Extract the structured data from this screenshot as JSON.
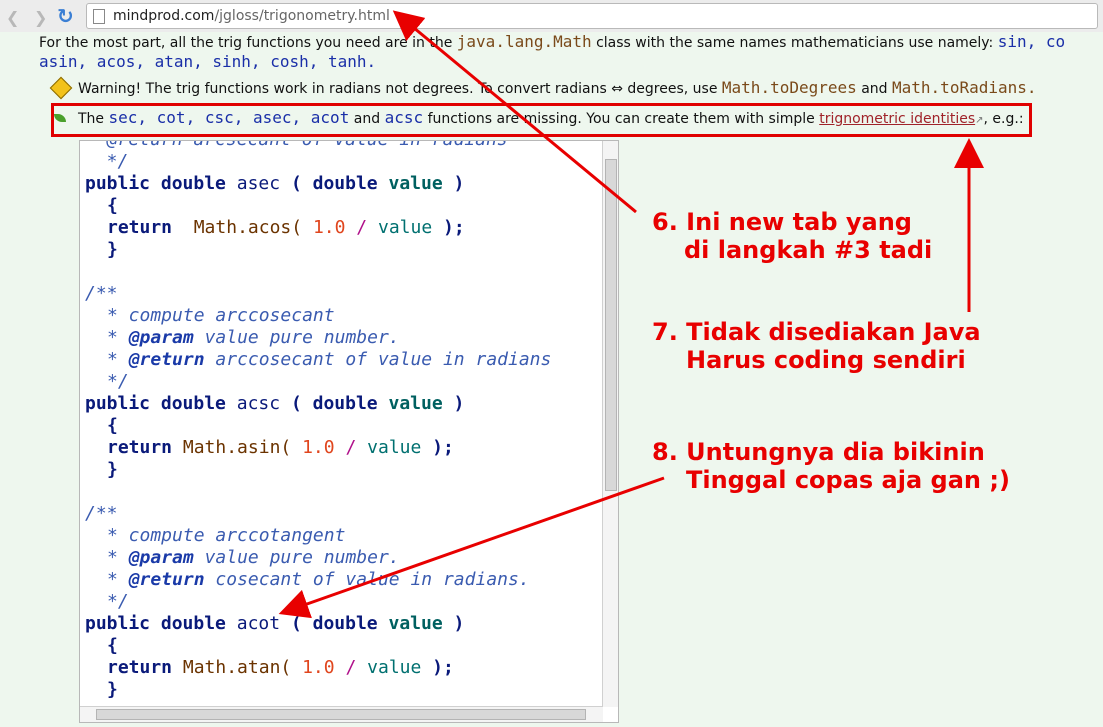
{
  "browser": {
    "url_domain": "mindprod.com",
    "url_path": "/jgloss/trigonometry.html"
  },
  "page": {
    "intro_line1_a": "For the most part, all the trig functions you need are in the",
    "intro_code1": "java.lang.Math",
    "intro_line1_b": "class with the same names mathematicians use namely:",
    "intro_code2": "sin, co",
    "intro_line2_code": "asin, acos, atan, sinh, cosh, tanh.",
    "warning_a": "Warning! The trig functions work in radians not degrees. To convert radians ⇔ degrees, use",
    "warning_code1": "Math.toDegrees",
    "warning_and": "and",
    "warning_code2": "Math.toRadians.",
    "tip_the": "The",
    "tip_code": "sec, cot, csc, asec, acot",
    "tip_and": "and",
    "tip_code2": "acsc",
    "tip_b": "functions are missing. You can create them with simple",
    "tip_link": "trignometric identities",
    "tip_c": ", e.g.:"
  },
  "code": {
    "l0": "  @return arcsecant of value in radians",
    "l1": "  */",
    "sig1_kw": "public double",
    "sig1_fn": "asec",
    "sig_open": "(",
    "sig_double": "double",
    "sig_value": "value",
    "sig_close": ")",
    "brace_open": "{",
    "ret": "return",
    "math_acos": "Math.acos(",
    "one": "1.0",
    "slash": "/",
    "value": "value",
    "end": ");",
    "brace_close": "}",
    "cstart": "/**",
    "c_acsc": "* compute arccosecant",
    "c_param_tag": "@param",
    "c_param": "value pure number.",
    "c_return_tag": "@return",
    "c_return_acsc": "arccosecant of value in radians",
    "c_end": "*/",
    "sig2_fn": "acsc",
    "math_asin": "Math.asin(",
    "c_acot": "* compute arccotangent",
    "c_return_acot": "cosecant of value in radians.",
    "sig3_fn": "acot",
    "math_atan": "Math.atan("
  },
  "annotations": {
    "a6_line1": "6. Ini new tab yang",
    "a6_line2": "di langkah #3 tadi",
    "a7_line1": "7. Tidak disediakan Java",
    "a7_line2": "Harus coding sendiri",
    "a8_line1": "8. Untungnya dia bikinin",
    "a8_line2": "Tinggal copas aja gan ;)"
  },
  "colors": {
    "annotation": "#e80000",
    "link": "#a0232a"
  }
}
